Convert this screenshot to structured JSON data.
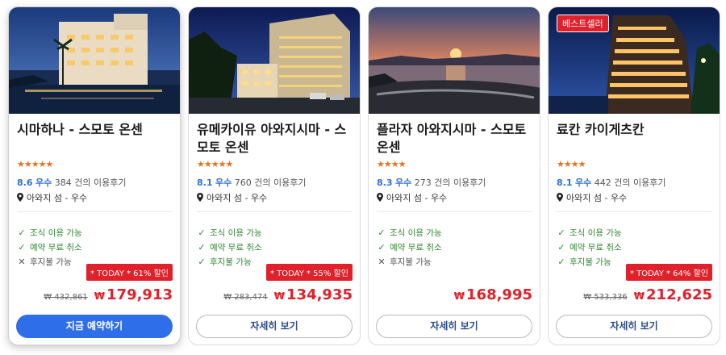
{
  "currency_symbol": "₩",
  "colors": {
    "accent": "#2e6ee8",
    "price_red": "#e0202a",
    "star_orange": "#e8721c",
    "check_green": "#2f8a2f"
  },
  "cards": [
    {
      "badge": "",
      "title": "시마하나 - 스모토 온센",
      "stars": "★★★★★",
      "score": "8.6",
      "score_word": "우수",
      "review_count": "384",
      "review_suffix": "건의 이용후기",
      "location": "아와지 섬 - 우수",
      "features": [
        {
          "icon": "check-icon",
          "text": "조식 이용 가능"
        },
        {
          "icon": "check-icon",
          "text": "예약 무료 취소"
        },
        {
          "icon": "x-icon",
          "text": "후지불 가능"
        }
      ],
      "today_label": "* TODAY * 61% 할인",
      "original_price": "₩ 432,861",
      "price": "179,913",
      "button": "지금 예약하기"
    },
    {
      "badge": "",
      "title": "유메카이유 아와지시마 - 스모토 온센",
      "stars": "★★★★★",
      "score": "8.1",
      "score_word": "우수",
      "review_count": "760",
      "review_suffix": "건의 이용후기",
      "location": "아와지 섬 - 우수",
      "features": [
        {
          "icon": "check-icon",
          "text": "조식 이용 가능"
        },
        {
          "icon": "check-icon",
          "text": "예약 무료 취소"
        },
        {
          "icon": "check-icon",
          "text": "후지불 가능"
        }
      ],
      "today_label": "* TODAY * 55% 할인",
      "original_price": "₩ 283,474",
      "price": "134,935",
      "button": "자세히 보기"
    },
    {
      "badge": "",
      "title": "플라자 아와지시마 - 스모토 온센",
      "stars": "★★★★",
      "score": "8.3",
      "score_word": "우수",
      "review_count": "273",
      "review_suffix": "건의 이용후기",
      "location": "아와지 섬 - 우수",
      "features": [
        {
          "icon": "check-icon",
          "text": "조식 이용 가능"
        },
        {
          "icon": "check-icon",
          "text": "예약 무료 취소"
        },
        {
          "icon": "x-icon",
          "text": "후지불 가능"
        }
      ],
      "today_label": "",
      "original_price": "",
      "price": "168,995",
      "button": "자세히 보기"
    },
    {
      "badge": "베스트셀러",
      "title": "료칸 카이게츠칸",
      "stars": "★★★★",
      "score": "8.1",
      "score_word": "우수",
      "review_count": "442",
      "review_suffix": "건의 이용후기",
      "location": "아와지 섬 - 우수",
      "features": [
        {
          "icon": "check-icon",
          "text": "조식 이용 가능"
        },
        {
          "icon": "check-icon",
          "text": "예약 무료 취소"
        },
        {
          "icon": "check-icon",
          "text": "후지불 가능"
        }
      ],
      "today_label": "* TODAY * 64% 할인",
      "original_price": "₩ 533,336",
      "price": "212,625",
      "button": "자세히 보기"
    }
  ]
}
